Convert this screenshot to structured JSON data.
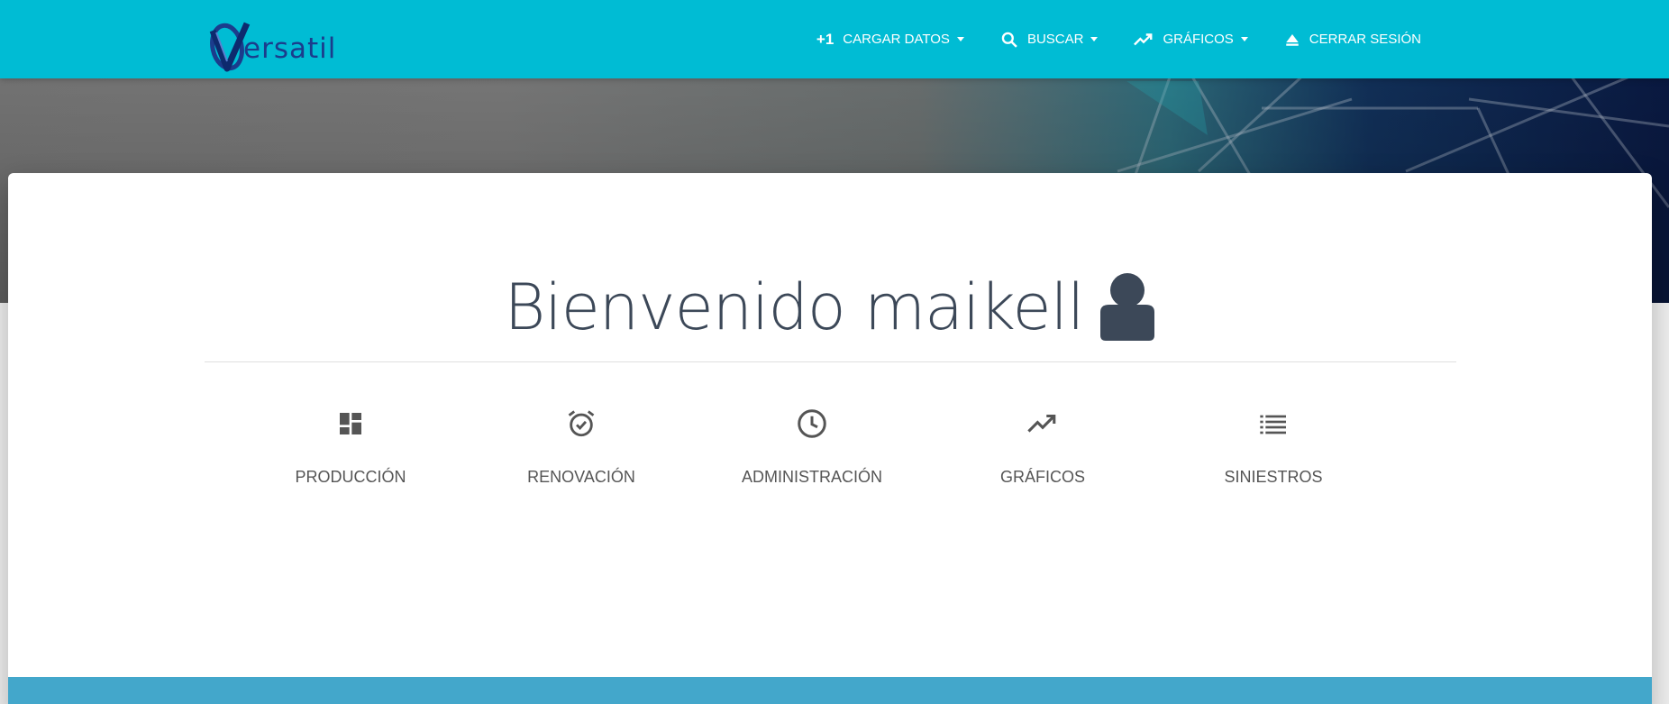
{
  "app": {
    "logo_text": "ersatil"
  },
  "nav": {
    "items": [
      {
        "label": "CARGAR DATOS",
        "icon": "plus-one-icon",
        "prefix": "+1"
      },
      {
        "label": "BUSCAR",
        "icon": "search-icon"
      },
      {
        "label": "GRÁFICOS",
        "icon": "trending-up-icon"
      },
      {
        "label": "CERRAR SESIÓN",
        "icon": "eject-icon"
      }
    ]
  },
  "welcome": {
    "text": "Bienvenido maikell",
    "icon": "user-icon"
  },
  "menu": {
    "items": [
      {
        "label": "PRODUCCIÓN",
        "icon": "dashboard-icon"
      },
      {
        "label": "RENOVACIÓN",
        "icon": "alarm-on-icon"
      },
      {
        "label": "ADMINISTRACIÓN",
        "icon": "clock-icon"
      },
      {
        "label": "GRÁFICOS",
        "icon": "trending-up-icon"
      },
      {
        "label": "SINIESTROS",
        "icon": "list-icon"
      }
    ]
  },
  "colors": {
    "navbar": "#00bcd4",
    "text_dark": "#3c4858",
    "menu_text": "#555555",
    "footer_band": "#43a7cb"
  }
}
